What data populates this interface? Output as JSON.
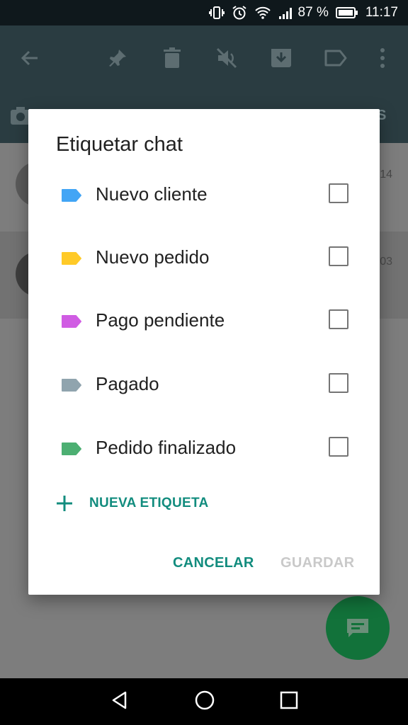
{
  "status_bar": {
    "battery_percent": "87 %",
    "time": "11:17",
    "icons": [
      "vibrate-icon",
      "alarm-icon",
      "wifi-icon",
      "signal-icon",
      "battery-icon"
    ]
  },
  "toolbar": {
    "actions": [
      "back-arrow-icon",
      "pin-icon",
      "delete-icon",
      "mute-icon",
      "archive-icon",
      "label-icon",
      "more-vert-icon"
    ],
    "tab_hint_right": "S"
  },
  "chat_list": {
    "rows": [
      {
        "time_fragment": "14"
      },
      {
        "time_fragment": "03"
      }
    ]
  },
  "dialog": {
    "title": "Etiquetar chat",
    "labels": [
      {
        "name": "Nuevo cliente",
        "color": "#42a5f5",
        "checked": false
      },
      {
        "name": "Nuevo pedido",
        "color": "#ffca28",
        "checked": false
      },
      {
        "name": "Pago pendiente",
        "color": "#d05ce3",
        "checked": false
      },
      {
        "name": "Pagado",
        "color": "#90a4ae",
        "checked": false
      },
      {
        "name": "Pedido finalizado",
        "color": "#4caf72",
        "checked": false
      }
    ],
    "new_label": "NUEVA ETIQUETA",
    "cancel": "CANCELAR",
    "save": "GUARDAR"
  },
  "colors": {
    "accent": "#128c7e",
    "fab": "#12723a",
    "toolbar": "#2a3c41"
  }
}
